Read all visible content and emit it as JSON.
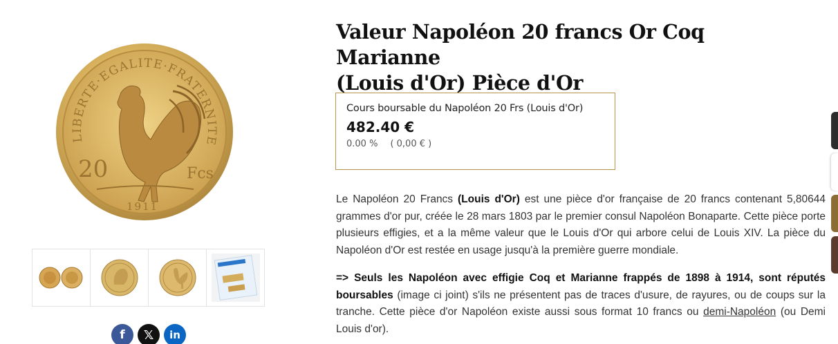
{
  "product": {
    "title_line1": "Valeur Napoléon 20 francs Or Coq Marianne",
    "title_line2": "(Louis d'Or) Pièce d'Or"
  },
  "coin_image": {
    "top_legend": "LIBERTE·EGALITE·FRATERNITE",
    "denomination_left": "20",
    "denomination_right": "Fcs",
    "year": "1911"
  },
  "gallery": {
    "thumbnails": [
      {
        "name": "thumb-pair"
      },
      {
        "name": "thumb-marianne"
      },
      {
        "name": "thumb-coq"
      },
      {
        "name": "thumb-packaged"
      }
    ]
  },
  "price_box": {
    "label": "Cours boursable du Napoléon 20 Frs (Louis d'Or)",
    "value": "482.40 €",
    "change_pct": "0.00 %",
    "change_abs": "( 0,00 € )"
  },
  "description": {
    "p1_before": "Le Napoléon 20 Francs ",
    "p1_bold": "(Louis d'Or)",
    "p1_after": " est une pièce d'or française de 20 francs contenant 5,80644 grammes d'or pur, créée le 28 mars 1803 par le premier consul Napoléon Bonaparte. Cette pièce porte plusieurs effigies, et a la même valeur que le Louis d'Or qui arbore celui de Louis XIV. La pièce du Napoléon d'Or est restée en usage jusqu'à la première guerre mondiale.",
    "p2_bold": "=> Seuls les Napoléon avec effigie Coq et Marianne frappés de 1898 à 1914, sont réputés boursables",
    "p2_after": " (image ci joint) s'ils ne présentent pas de traces d'usure, de rayures, ou de coups sur la tranche. Cette pièce d'or Napoléon existe aussi sous format 10 francs ou ",
    "p2_link": "demi-Napoléon",
    "p2_end": " (ou Demi Louis d'or)."
  },
  "social": {
    "facebook_icon": "f",
    "x_icon": "𝕏",
    "linkedin_icon": "in"
  },
  "colors": {
    "gold_border": "#b8934a",
    "facebook": "#3b5998",
    "x": "#111111",
    "linkedin": "#0a66c2"
  }
}
